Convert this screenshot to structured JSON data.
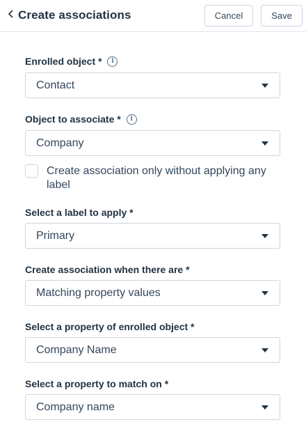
{
  "header": {
    "title": "Create associations",
    "cancel_label": "Cancel",
    "save_label": "Save"
  },
  "fields": {
    "enrolled_object": {
      "label": "Enrolled object *",
      "value": "Contact"
    },
    "object_to_associate": {
      "label": "Object to associate *",
      "value": "Company"
    },
    "checkbox": {
      "label": "Create association only without applying any label",
      "checked": false
    },
    "label_to_apply": {
      "label": "Select a label to apply *",
      "value": "Primary"
    },
    "association_condition": {
      "label": "Create association when there are *",
      "value": "Matching property values"
    },
    "enrolled_property": {
      "label": "Select a property of enrolled object *",
      "value": "Company Name"
    },
    "match_property": {
      "label": "Select a property to match on *",
      "value": "Company name"
    }
  },
  "icons": {
    "info": "info-icon",
    "back": "chevron-left-icon",
    "dropdown": "caret-down-icon"
  }
}
